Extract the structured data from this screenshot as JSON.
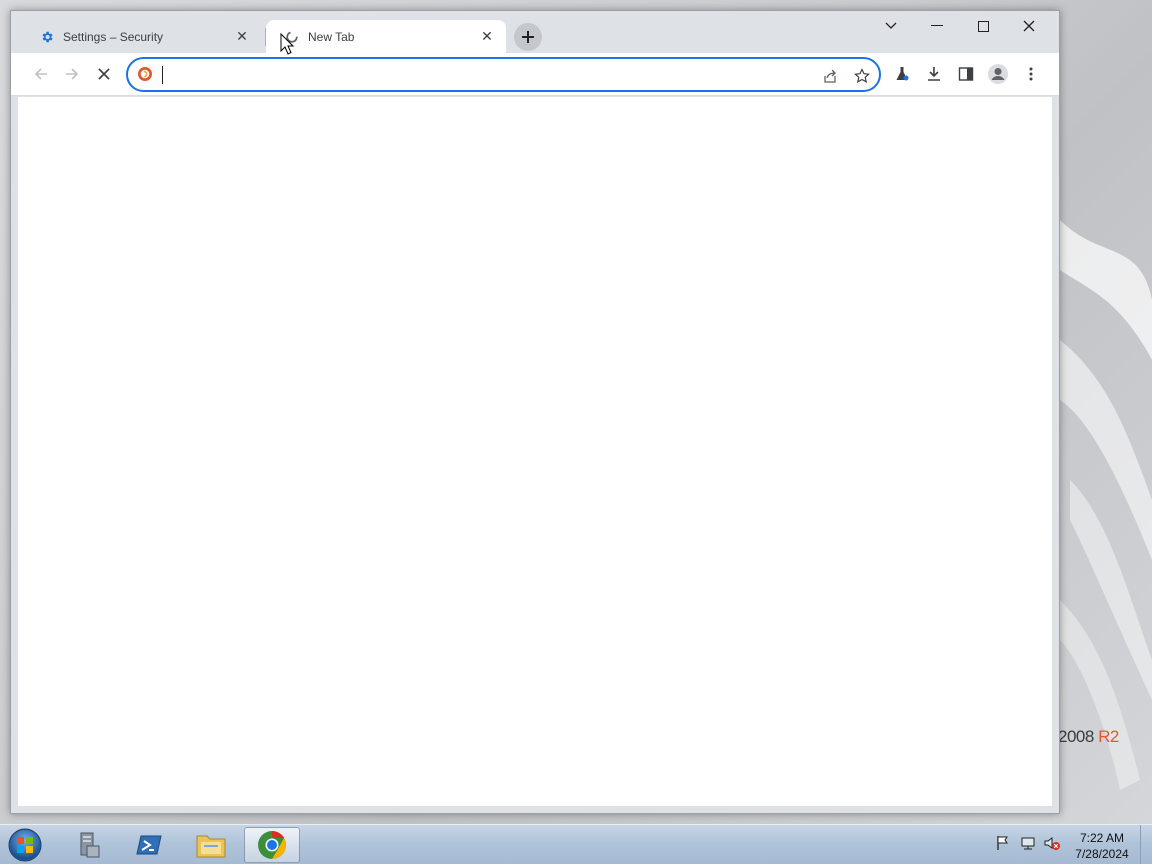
{
  "desktop": {
    "brand_text": "2008",
    "brand_suffix": "R2"
  },
  "browser": {
    "tabs": [
      {
        "title": "Settings – Security",
        "favicon": "gear-icon",
        "active": false
      },
      {
        "title": "New Tab",
        "favicon": "loading-spinner-icon",
        "active": true
      }
    ],
    "toolbar": {
      "back_icon": "arrow-left-icon",
      "forward_icon": "arrow-right-icon",
      "stop_icon": "stop-x-icon",
      "address_value": "",
      "site_icon": "duckduckgo-icon",
      "share_icon": "share-icon",
      "bookmark_icon": "star-icon",
      "labs_icon": "flask-icon",
      "download_icon": "download-icon",
      "side_panel_icon": "side-panel-icon",
      "profile_icon": "avatar-icon",
      "menu_icon": "kebab-menu-icon"
    },
    "colors": {
      "accent": "#1a73e8",
      "tab_strip": "#dee1e6",
      "active_tab": "#ffffff"
    }
  },
  "taskbar": {
    "apps": [
      {
        "name": "start-orb",
        "active": false
      },
      {
        "name": "server-manager",
        "active": false
      },
      {
        "name": "powershell",
        "active": false
      },
      {
        "name": "file-explorer",
        "active": false
      },
      {
        "name": "chrome",
        "active": true
      }
    ],
    "tray_icons": [
      "flag-icon",
      "network-icon",
      "speaker-muted-icon"
    ],
    "time": "7:22 AM",
    "date": "7/28/2024"
  }
}
